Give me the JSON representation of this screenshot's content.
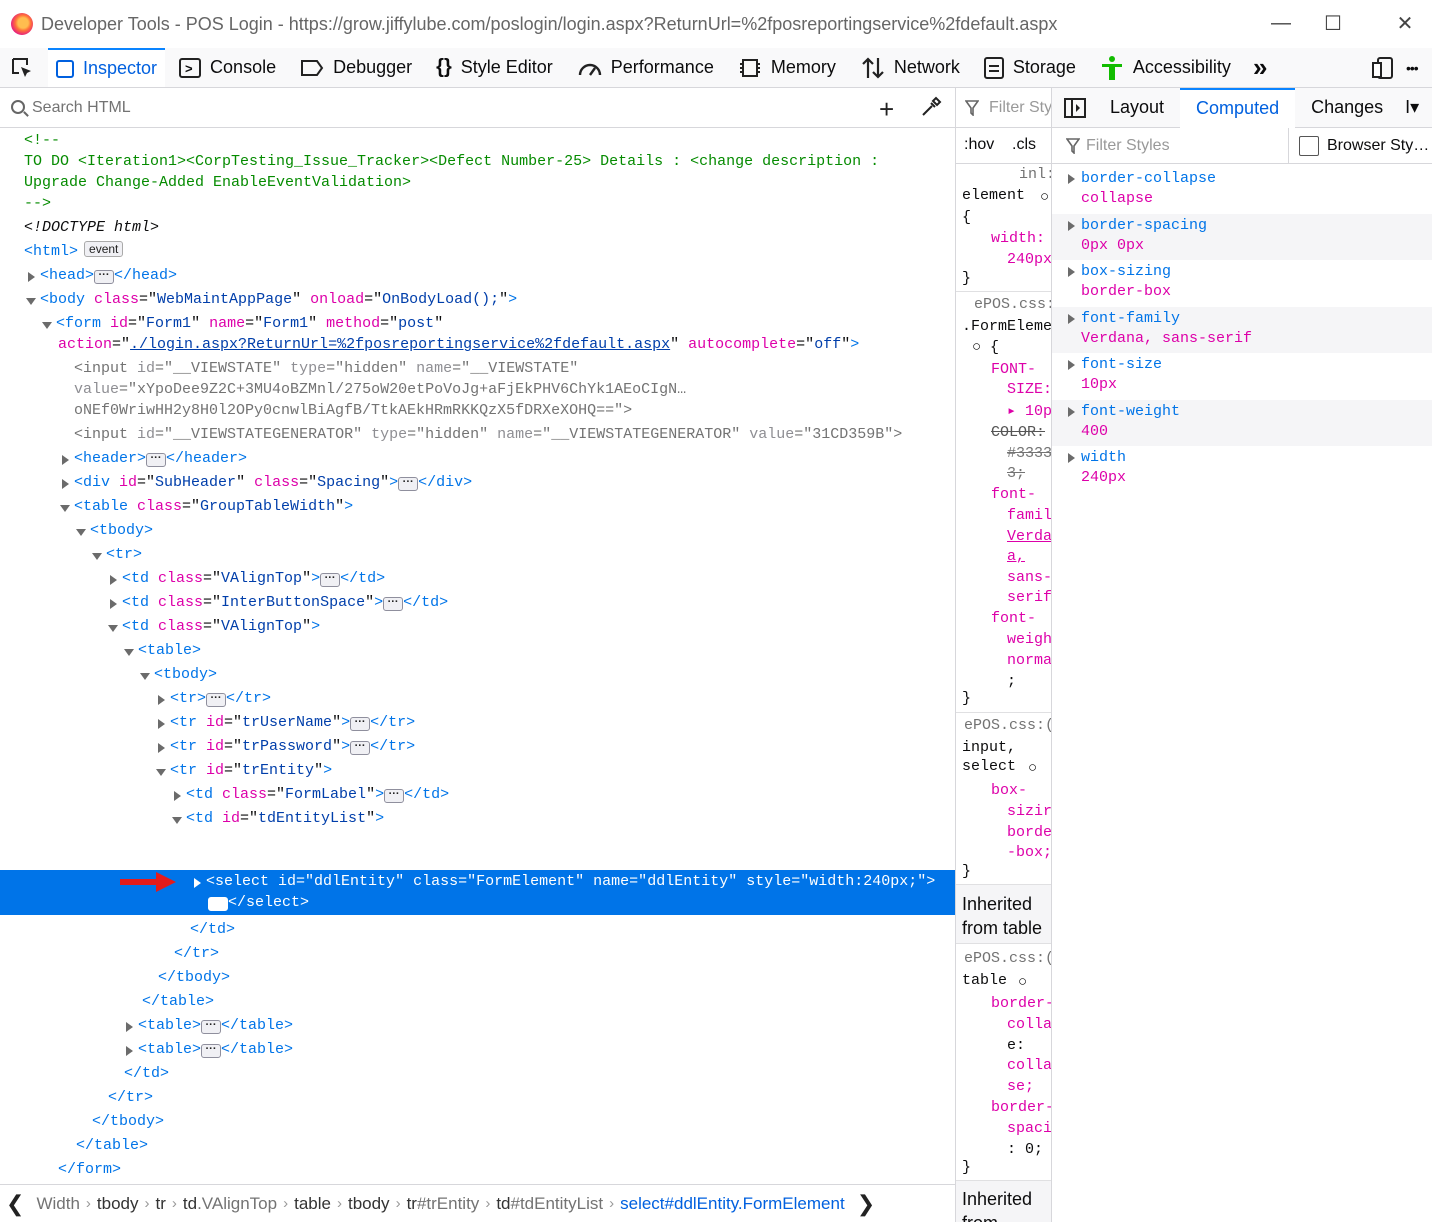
{
  "window": {
    "title": "Developer Tools - POS Login - https://grow.jiffylube.com/poslogin/login.aspx?ReturnUrl=%2fposreportingservice%2fdefault.aspx"
  },
  "toolbar": {
    "tabs": [
      {
        "label": "Inspector",
        "icon": "inspector-icon",
        "selected": true
      },
      {
        "label": "Console",
        "icon": "console-icon"
      },
      {
        "label": "Debugger",
        "icon": "debugger-icon"
      },
      {
        "label": "Style Editor",
        "icon": "style-editor-icon"
      },
      {
        "label": "Performance",
        "icon": "performance-icon"
      },
      {
        "label": "Memory",
        "icon": "memory-icon"
      },
      {
        "label": "Network",
        "icon": "network-icon"
      },
      {
        "label": "Storage",
        "icon": "storage-icon"
      },
      {
        "label": "Accessibility",
        "icon": "accessibility-icon"
      }
    ],
    "overflow": "»",
    "more": "•••"
  },
  "markup": {
    "search_placeholder": "Search HTML",
    "comment_open": "<!--",
    "comment_text": "TO DO <Iteration1><CorpTesting_Issue_Tracker><Defect Number-25> Details : <change description :",
    "comment_text2": "Upgrade Change-Added EnableEventValidation>",
    "comment_close": "-->",
    "doctype": "<!DOCTYPE html>",
    "html_badge": "event",
    "body_class": "WebMaintAppPage",
    "body_onload": "OnBodyLoad();",
    "form_id": "Form1",
    "form_name": "Form1",
    "form_method": "post",
    "form_action": "./login.aspx?ReturnUrl=%2fposreportingservice%2fdefault.aspx",
    "form_autocomplete": "off",
    "vs_id": "__VIEWSTATE",
    "vs_type": "hidden",
    "vs_name": "__VIEWSTATE",
    "vs_value1": "xYpoDee9Z2C+3MU4oBZMnl/275oW20etPoVoJg+aFjEkPHV6ChYk1AEoCIgN…",
    "vs_value2": "oNEf0WriwHH2y8H0l2OPy0cnwlBiAgfB/TtkAEkHRmRKKQzX5fDRXeXOHQ==\">",
    "vsg_id": "__VIEWSTATEGENERATOR",
    "vsg_type": "hidden",
    "vsg_name": "__VIEWSTATEGENERATOR",
    "vsg_value": "31CD359B",
    "subheader_id": "SubHeader",
    "subheader_class": "Spacing",
    "table_class": "GroupTableWidth",
    "td1_class": "VAlignTop",
    "td2_class": "InterButtonSpace",
    "td3_class": "VAlignTop",
    "tr_user": "trUserName",
    "tr_pass": "trPassword",
    "tr_entity": "trEntity",
    "td_label_class": "FormLabel",
    "td_entity_id": "tdEntityList",
    "select_id": "ddlEntity",
    "select_class": "FormElement",
    "select_name": "ddlEntity",
    "select_style": "width:240px;"
  },
  "breadcrumb": [
    {
      "tag": "Width",
      "suffix": ""
    },
    {
      "tag": "tbody",
      "suffix": ""
    },
    {
      "tag": "tr",
      "suffix": ""
    },
    {
      "tag": "td",
      "suffix": ".VAlignTop"
    },
    {
      "tag": "table",
      "suffix": ""
    },
    {
      "tag": "tbody",
      "suffix": ""
    },
    {
      "tag": "tr",
      "suffix": "#trEntity"
    },
    {
      "tag": "td",
      "suffix": "#tdEntityList"
    },
    {
      "tag": "select",
      "suffix": "#ddlEntity.FormElement"
    }
  ],
  "rules": {
    "filter_placeholder": "Filter Sty",
    "hov": ":hov",
    "cls": ".cls",
    "inline": "inl:",
    "element_selector": "element",
    "brace_open": "{",
    "brace_close": "}",
    "width_prop": "width:",
    "width_val": "240px",
    "source1": "ePOS.css:",
    "selector1": ".FormEleme",
    "font_size_prop1": "FONT-",
    "font_size_prop2": "SIZE:",
    "font_size_val": "10p:",
    "color_prop": "COLOR:",
    "color_val1": "#3333",
    "color_val2": "3;",
    "font_family_prop1": "font-",
    "font_family_prop2": "famil",
    "font_family_val1": "Verda",
    "font_family_val2": "a,",
    "font_family_val3": "sans-",
    "font_family_val4": "serif",
    "font_weight_prop1": "font-",
    "font_weight_prop2": "weigh",
    "font_weight_val": "norma",
    "semicolon": ";",
    "source2": "ePOS.css:(",
    "selector2a": "input,",
    "selector2b": "select",
    "box_prop1": "box-",
    "box_prop2": "sizir",
    "box_val1": "borde",
    "box_val2": "-box;",
    "inherited_table1": "Inherited",
    "inherited_table2": "from table",
    "source3": "ePOS.css:(",
    "selector3": "table",
    "bc_prop1": "border-",
    "bc_prop2": "colla",
    "bc_prop3": "e:",
    "bc_val1": "colla",
    "bc_val2": "se;",
    "bs_prop1": "border-",
    "bs_prop2": "spaci",
    "bs_val": ": 0;",
    "inherited_bottom1": "Inherited",
    "inherited_bottom2": "from"
  },
  "sidepanel": {
    "tabs": [
      {
        "label": "Layout"
      },
      {
        "label": "Computed",
        "active": true
      },
      {
        "label": "Changes"
      },
      {
        "label": "I▾"
      }
    ],
    "filter_placeholder": "Filter Styles",
    "browser_styles_label": "Browser Sty…",
    "computed": [
      {
        "name": "border-collapse",
        "value": "collapse"
      },
      {
        "name": "border-spacing",
        "value": "0px 0px"
      },
      {
        "name": "box-sizing",
        "value": "border-box"
      },
      {
        "name": "font-family",
        "value": "Verdana, sans-serif"
      },
      {
        "name": "font-size",
        "value": "10px"
      },
      {
        "name": "font-weight",
        "value": "400"
      },
      {
        "name": "width",
        "value": "240px"
      }
    ]
  }
}
